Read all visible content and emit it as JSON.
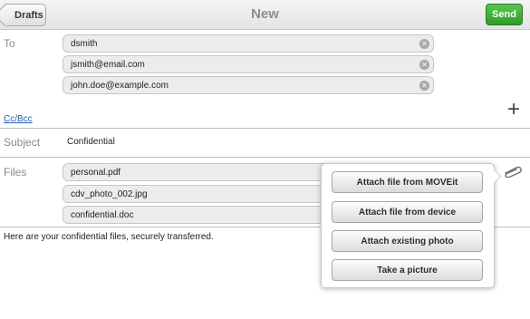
{
  "header": {
    "back_label": "Drafts",
    "title": "New",
    "send_label": "Send"
  },
  "to": {
    "label": "To",
    "recipients": [
      "dsmith",
      "jsmith@email.com",
      "john.doe@example.com"
    ]
  },
  "cc_bcc_label": "Cc/Bcc",
  "add_icon": "plus-icon",
  "subject": {
    "label": "Subject",
    "value": "Confidential"
  },
  "files": {
    "label": "Files",
    "items": [
      "personal.pdf",
      "cdv_photo_002.jpg",
      "confidential.doc"
    ]
  },
  "attach_icon": "paperclip-icon",
  "attach_menu": {
    "options": [
      "Attach file from MOVEit",
      "Attach file from device",
      "Attach existing photo",
      "Take a picture"
    ]
  },
  "message_body": "Here are your confidential files, securely transferred.",
  "colors": {
    "send_green": "#3aab33",
    "link_blue": "#1f5fb0"
  }
}
